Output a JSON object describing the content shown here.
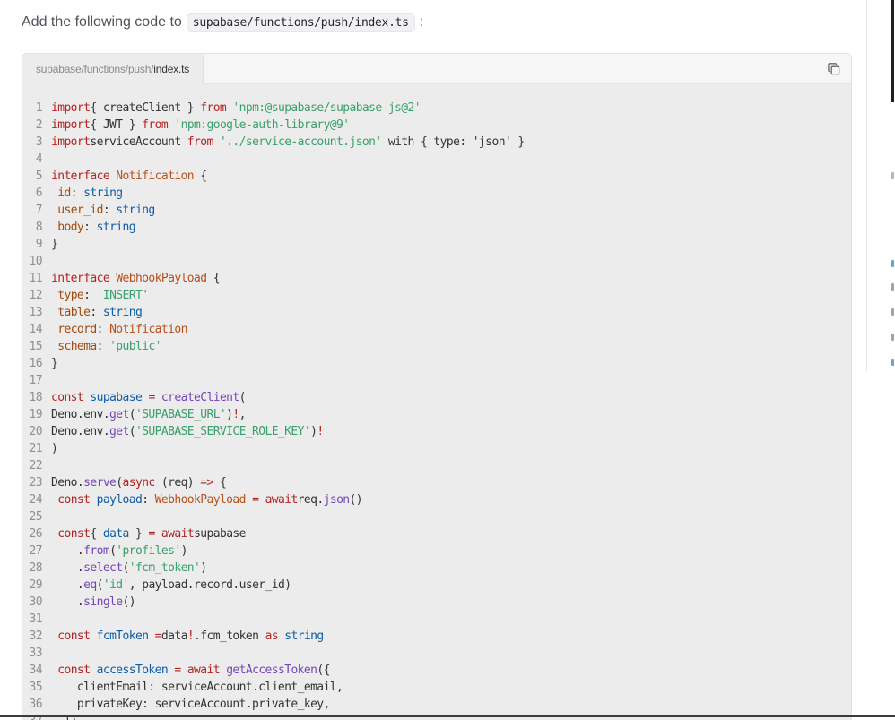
{
  "intro": {
    "before": "Add the following code to",
    "path": "supabase/functions/push/index.ts",
    "after": ":"
  },
  "code_block": {
    "tab_dir": "supabase/functions/push/",
    "tab_file": "index.ts",
    "copy_icon": "copy-icon"
  },
  "lines": [
    [
      [
        "kw",
        "import"
      ],
      [
        "",
        "{ createClient } "
      ],
      [
        "kw",
        "from"
      ],
      [
        "",
        ""
      ],
      [
        "str",
        "'npm:@supabase/supabase-js@2'"
      ]
    ],
    [
      [
        "kw",
        "import"
      ],
      [
        "",
        "{ JWT } "
      ],
      [
        "kw",
        "from"
      ],
      [
        "",
        ""
      ],
      [
        "str",
        "'npm:google-auth-library@9'"
      ]
    ],
    [
      [
        "kw",
        "import"
      ],
      [
        "",
        "serviceAccount "
      ],
      [
        "kw",
        "from"
      ],
      [
        "",
        ""
      ],
      [
        "str",
        "'../service-account.json'"
      ],
      [
        "",
        ""
      ],
      [
        "",
        "with { type: 'json' }"
      ]
    ],
    [],
    [
      [
        "kw",
        "interface"
      ],
      [
        "",
        ""
      ],
      [
        "typ",
        "Notification"
      ],
      [
        "",
        " {"
      ]
    ],
    [
      [
        "",
        " "
      ],
      [
        "prop",
        "id"
      ],
      [
        "",
        ": "
      ],
      [
        "ty",
        "string"
      ]
    ],
    [
      [
        "",
        " "
      ],
      [
        "prop",
        "user_id"
      ],
      [
        "",
        ": "
      ],
      [
        "ty",
        "string"
      ]
    ],
    [
      [
        "",
        " "
      ],
      [
        "prop",
        "body"
      ],
      [
        "",
        ": "
      ],
      [
        "ty",
        "string"
      ]
    ],
    [
      [
        "",
        "}"
      ]
    ],
    [],
    [
      [
        "kw",
        "interface"
      ],
      [
        "",
        ""
      ],
      [
        "typ",
        "WebhookPayload"
      ],
      [
        "",
        " {"
      ]
    ],
    [
      [
        "",
        " "
      ],
      [
        "prop",
        "type"
      ],
      [
        "",
        ": "
      ],
      [
        "str",
        "'INSERT'"
      ]
    ],
    [
      [
        "",
        " "
      ],
      [
        "prop",
        "table"
      ],
      [
        "",
        ": "
      ],
      [
        "ty",
        "string"
      ]
    ],
    [
      [
        "",
        " "
      ],
      [
        "prop",
        "record"
      ],
      [
        "",
        ": "
      ],
      [
        "typ",
        "Notification"
      ]
    ],
    [
      [
        "",
        " "
      ],
      [
        "prop",
        "schema"
      ],
      [
        "",
        ": "
      ],
      [
        "str",
        "'public'"
      ]
    ],
    [
      [
        "",
        "}"
      ]
    ],
    [],
    [
      [
        "kw",
        "const"
      ],
      [
        "",
        ""
      ],
      [
        "var",
        "supabase"
      ],
      [
        "",
        " "
      ],
      [
        "kw",
        "="
      ],
      [
        "",
        ""
      ],
      [
        "fn",
        "createClient"
      ],
      [
        "",
        "("
      ]
    ],
    [
      [
        "",
        "Deno.env."
      ],
      [
        "fn",
        "get"
      ],
      [
        "",
        "("
      ],
      [
        "str",
        "'SUPABASE_URL'"
      ],
      [
        "",
        ")"
      ],
      [
        "kw",
        "!"
      ],
      [
        "",
        ","
      ]
    ],
    [
      [
        "",
        "Deno.env."
      ],
      [
        "fn",
        "get"
      ],
      [
        "",
        "("
      ],
      [
        "str",
        "'SUPABASE_SERVICE_ROLE_KEY'"
      ],
      [
        "",
        ")"
      ],
      [
        "kw",
        "!"
      ]
    ],
    [
      [
        "",
        ")"
      ]
    ],
    [],
    [
      [
        "",
        "Deno."
      ],
      [
        "fn",
        "serve"
      ],
      [
        "",
        "("
      ],
      [
        "kw",
        "async"
      ],
      [
        "",
        " (req) "
      ],
      [
        "kw",
        "=>"
      ],
      [
        "",
        " {"
      ]
    ],
    [
      [
        "",
        " "
      ],
      [
        "kw",
        "const"
      ],
      [
        "",
        ""
      ],
      [
        "var",
        "payload"
      ],
      [
        "",
        ": "
      ],
      [
        "typ",
        "WebhookPayload"
      ],
      [
        "",
        " "
      ],
      [
        "kw",
        "="
      ],
      [
        "",
        ""
      ],
      [
        "kw",
        "await"
      ],
      [
        "",
        "req."
      ],
      [
        "fn",
        "json"
      ],
      [
        "",
        "()"
      ]
    ],
    [],
    [
      [
        "",
        " "
      ],
      [
        "kw",
        "const"
      ],
      [
        "",
        "{ "
      ],
      [
        "var",
        "data"
      ],
      [
        "",
        " } "
      ],
      [
        "kw",
        "="
      ],
      [
        "",
        ""
      ],
      [
        "kw",
        "await"
      ],
      [
        "",
        "supabase"
      ]
    ],
    [
      [
        "",
        "    ."
      ],
      [
        "fn",
        "from"
      ],
      [
        "",
        "("
      ],
      [
        "str",
        "'profiles'"
      ],
      [
        "",
        ")"
      ]
    ],
    [
      [
        "",
        "    ."
      ],
      [
        "fn",
        "select"
      ],
      [
        "",
        "("
      ],
      [
        "str",
        "'fcm_token'"
      ],
      [
        "",
        ")"
      ]
    ],
    [
      [
        "",
        "    ."
      ],
      [
        "fn",
        "eq"
      ],
      [
        "",
        "("
      ],
      [
        "str",
        "'id'"
      ],
      [
        "",
        ", payload.record.user_id)"
      ]
    ],
    [
      [
        "",
        "    ."
      ],
      [
        "fn",
        "single"
      ],
      [
        "",
        "()"
      ]
    ],
    [],
    [
      [
        "",
        " "
      ],
      [
        "kw",
        "const"
      ],
      [
        "",
        ""
      ],
      [
        "var",
        "fcmToken"
      ],
      [
        "",
        " "
      ],
      [
        "kw",
        "="
      ],
      [
        "",
        "data"
      ],
      [
        "kw",
        "!"
      ],
      [
        "",
        ".fcm_token "
      ],
      [
        "kw",
        "as"
      ],
      [
        "",
        ""
      ],
      [
        "ty",
        "string"
      ]
    ],
    [],
    [
      [
        "",
        " "
      ],
      [
        "kw",
        "const"
      ],
      [
        "",
        ""
      ],
      [
        "var",
        "accessToken"
      ],
      [
        "",
        " "
      ],
      [
        "kw",
        "="
      ],
      [
        "",
        ""
      ],
      [
        "kw",
        "await"
      ],
      [
        "",
        ""
      ],
      [
        "fn",
        "getAccessToken"
      ],
      [
        "",
        "({"
      ]
    ],
    [
      [
        "",
        "    clientEmail: serviceAccount.client_email,"
      ]
    ],
    [
      [
        "",
        "    privateKey: serviceAccount.private_key,"
      ]
    ],
    [
      [
        "",
        "  })"
      ]
    ]
  ],
  "colors": {
    "keyword": "#b42323",
    "string": "#3aa06c",
    "function": "#7646b8",
    "type_keyword": "#0e5ca8",
    "type_name": "#b8501e",
    "property": "#a44a0c"
  }
}
